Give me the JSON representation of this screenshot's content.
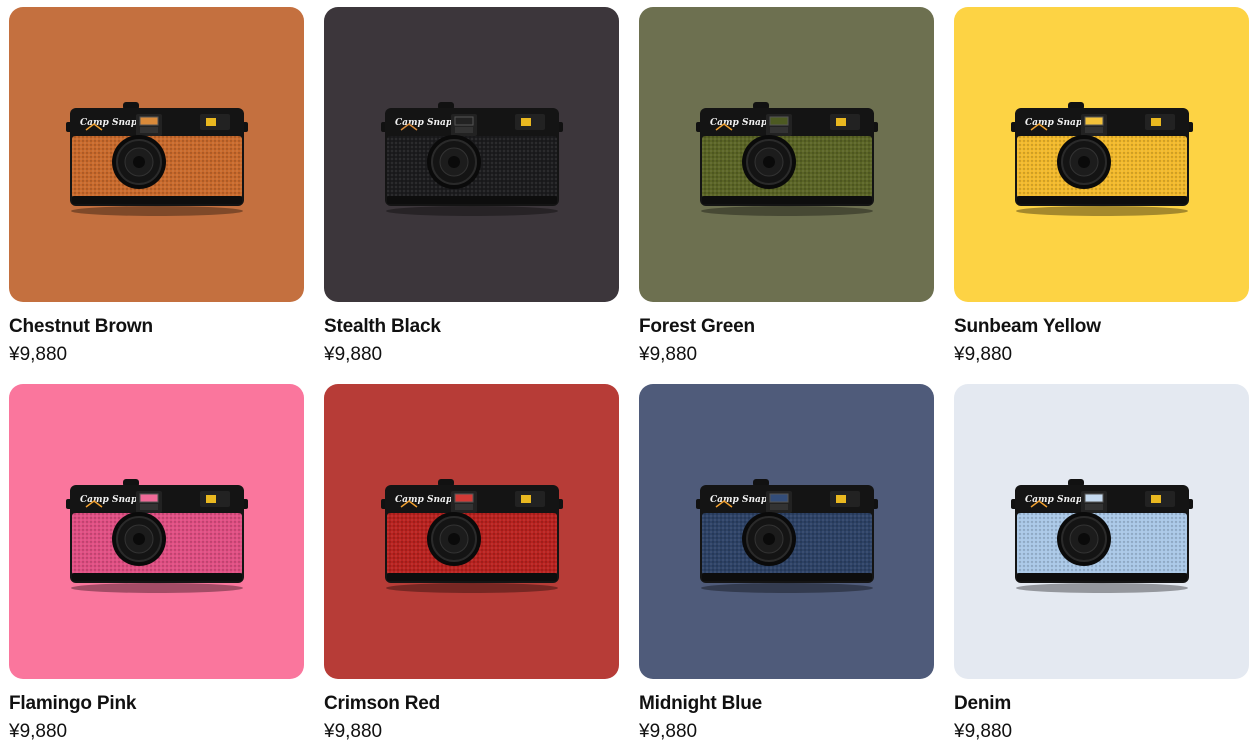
{
  "products": [
    {
      "name": "Chestnut Brown",
      "price": "¥9,880",
      "bg": "#c4703f",
      "body": "#c96a2c",
      "accent": "#d98a3a"
    },
    {
      "name": "Stealth Black",
      "price": "¥9,880",
      "bg": "#3c363b",
      "body": "#1c1c1e",
      "accent": "#222222"
    },
    {
      "name": "Forest Green",
      "price": "¥9,880",
      "bg": "#6d7050",
      "body": "#5a6425",
      "accent": "#4d5a22"
    },
    {
      "name": "Sunbeam Yellow",
      "price": "¥9,880",
      "bg": "#fdd344",
      "body": "#f2b92b",
      "accent": "#f3c23a"
    },
    {
      "name": "Flamingo Pink",
      "price": "¥9,880",
      "bg": "#fa769d",
      "body": "#e04f83",
      "accent": "#f06a98"
    },
    {
      "name": "Crimson Red",
      "price": "¥9,880",
      "bg": "#b73c37",
      "body": "#b8221f",
      "accent": "#d23a36"
    },
    {
      "name": "Midnight Blue",
      "price": "¥9,880",
      "bg": "#4f5b7a",
      "body": "#2d4266",
      "accent": "#334d79"
    },
    {
      "name": "Denim",
      "price": "¥9,880",
      "bg": "#e4e9f1",
      "body": "#a9c7e6",
      "accent": "#c5daf0"
    }
  ],
  "camera": {
    "brand_logo_text": "Camp Snap",
    "icon": "camera-product-image"
  }
}
